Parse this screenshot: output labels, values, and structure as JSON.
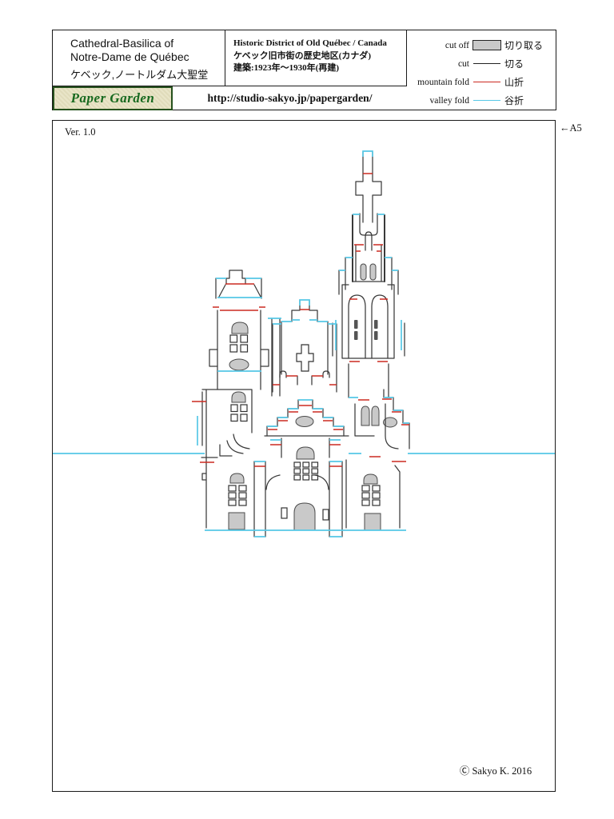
{
  "header": {
    "title_en_line1": "Cathedral-Basilica of",
    "title_en_line2": "Notre-Dame de Québec",
    "title_ja": "ケベック,ノートルダム大聖堂",
    "info_line1": "Historic District of Old Québec / Canada",
    "info_line2": "ケベック旧市街の歴史地区(カナダ)",
    "info_line3": "建築:1923年〜1930年(再建)",
    "logo_text": "Paper Garden",
    "url": "http://studio-sakyo.jp/papergarden/",
    "legend": {
      "items": [
        {
          "label_en": "cut off",
          "label_ja": "切り取る",
          "swatch": "gray-box"
        },
        {
          "label_en": "cut",
          "label_ja": "切る",
          "swatch": "black-line"
        },
        {
          "label_en": "mountain fold",
          "label_ja": "山折",
          "swatch": "red-line"
        },
        {
          "label_en": "valley fold",
          "label_ja": "谷折",
          "swatch": "cyan-line"
        }
      ]
    }
  },
  "sheet": {
    "version": "Ver.  1.0",
    "paper_size": "←A5",
    "copyright": "Ⓒ Sakyo K.  2016",
    "pattern_subject": "Cathedral-Basilica of Notre-Dame de Québec — origamic architecture cutting/folding pattern"
  },
  "colors": {
    "cut": "#3a3a3a",
    "mountain_fold": "#cc2a20",
    "valley_fold": "#56c8e6",
    "cut_off_fill": "#c9c9c9"
  }
}
